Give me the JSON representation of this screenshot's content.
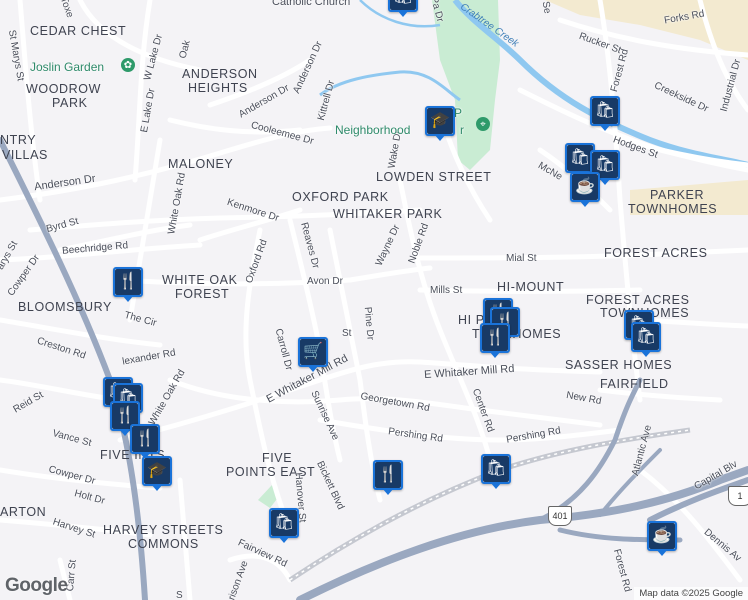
{
  "map": {
    "neighborhoods": [
      {
        "id": "cedar-chest",
        "text": "CEDAR CHEST"
      },
      {
        "id": "anderson-heights-1",
        "text": "ANDERSON"
      },
      {
        "id": "anderson-heights-2",
        "text": "HEIGHTS"
      },
      {
        "id": "woodrow-park-1",
        "text": "WOODROW"
      },
      {
        "id": "woodrow-park-2",
        "text": "PARK"
      },
      {
        "id": "country-villas-1",
        "text": "NTRY"
      },
      {
        "id": "country-villas-2",
        "text": "VILLAS"
      },
      {
        "id": "maloney",
        "text": "MALONEY"
      },
      {
        "id": "lowden-street",
        "text": "LOWDEN STREET"
      },
      {
        "id": "oxford-park",
        "text": "OXFORD PARK"
      },
      {
        "id": "whitaker-park",
        "text": "WHITAKER PARK"
      },
      {
        "id": "parker-townhomes-1",
        "text": "PARKER"
      },
      {
        "id": "parker-townhomes-2",
        "text": "TOWNHOMES"
      },
      {
        "id": "forest-acres",
        "text": "FOREST ACRES"
      },
      {
        "id": "white-oak-forest-1",
        "text": "WHITE OAK"
      },
      {
        "id": "white-oak-forest-2",
        "text": "FOREST"
      },
      {
        "id": "hi-mount",
        "text": "HI-MOUNT"
      },
      {
        "id": "bloomsbury",
        "text": "BLOOMSBURY"
      },
      {
        "id": "forest-acres-townhomes-1",
        "text": "FOREST ACRES"
      },
      {
        "id": "forest-acres-townhomes-2",
        "text": "TOWNHOMES"
      },
      {
        "id": "hi-park-townhomes-1",
        "text": "HI  PARK"
      },
      {
        "id": "hi-park-townhomes-2",
        "text": "TOWNHOMES"
      },
      {
        "id": "sasser-homes",
        "text": "SASSER HOMES"
      },
      {
        "id": "fairfield",
        "text": "FAIRFIELD"
      },
      {
        "id": "five-points",
        "text": "FIVE   INTS"
      },
      {
        "id": "five-points-east-1",
        "text": "FIVE"
      },
      {
        "id": "five-points-east-2",
        "text": "POINTS EAST"
      },
      {
        "id": "harvey-streets-1",
        "text": "HARVEY STREETS"
      },
      {
        "id": "harvey-streets-2",
        "text": "COMMONS"
      },
      {
        "id": "barton",
        "text": "ARTON"
      }
    ],
    "streets": [
      {
        "id": "catholic-church",
        "text": "Catholic Church"
      },
      {
        "id": "toxey",
        "text": "Toxe"
      },
      {
        "id": "st-marys-st-top",
        "text": "St Marys St"
      },
      {
        "id": "w-lake-dr",
        "text": "W Lake Dr"
      },
      {
        "id": "e-lake-dr",
        "text": "E Lake Dr"
      },
      {
        "id": "oakwood",
        "text": "Oak"
      },
      {
        "id": "anderson-dr-top",
        "text": "Anderson Dr"
      },
      {
        "id": "anderson-dr-mid",
        "text": "Anderson Dr"
      },
      {
        "id": "anderson-dr-left",
        "text": "Anderson Dr"
      },
      {
        "id": "kittrell",
        "text": "Kittrell Dr"
      },
      {
        "id": "cooleemee",
        "text": "Cooleemee Dr"
      },
      {
        "id": "wake-dr",
        "text": "Wake Dr"
      },
      {
        "id": "kenmore",
        "text": "Kenmore Dr"
      },
      {
        "id": "byrd",
        "text": "Byrd St"
      },
      {
        "id": "beechridge",
        "text": "Beechridge Rd"
      },
      {
        "id": "white-oak-rd",
        "text": "White Oak Rd"
      },
      {
        "id": "oxford-rd",
        "text": "Oxford Rd"
      },
      {
        "id": "reaves",
        "text": "Reaves Dr"
      },
      {
        "id": "wayne",
        "text": "Wayne Dr"
      },
      {
        "id": "noble",
        "text": "Noble Rd"
      },
      {
        "id": "avon",
        "text": "Avon Dr"
      },
      {
        "id": "mial",
        "text": "Mial St"
      },
      {
        "id": "mills",
        "text": "Mills St"
      },
      {
        "id": "cowper-dr",
        "text": "Cowper Dr"
      },
      {
        "id": "the-cir",
        "text": "The Cir"
      },
      {
        "id": "pine-dr",
        "text": "Pine Dr"
      },
      {
        "id": "creston",
        "text": "Creston Rd"
      },
      {
        "id": "alexander",
        "text": "lexander Rd"
      },
      {
        "id": "carroll",
        "text": "Carroll Dr"
      },
      {
        "id": "st-fragment",
        "text": "St"
      },
      {
        "id": "e-whitaker-mill-1",
        "text": "E Whitaker Mill Rd"
      },
      {
        "id": "e-whitaker-mill-2",
        "text": "E Whitaker Mill Rd"
      },
      {
        "id": "reid",
        "text": "Reid St"
      },
      {
        "id": "white-oak-rd-2",
        "text": "White Oak Rd"
      },
      {
        "id": "sunrise",
        "text": "Sunrise Ave"
      },
      {
        "id": "georgetown",
        "text": "Georgetown Rd"
      },
      {
        "id": "center",
        "text": "Center Rd"
      },
      {
        "id": "new-rd",
        "text": "New Rd"
      },
      {
        "id": "vance",
        "text": "Vance St"
      },
      {
        "id": "pershing-1",
        "text": "Pershing Rd"
      },
      {
        "id": "pershing-2",
        "text": "Pershing Rd"
      },
      {
        "id": "cowper-dr-2",
        "text": "Cowper Dr"
      },
      {
        "id": "holt",
        "text": "Holt Dr"
      },
      {
        "id": "bickett",
        "text": "Bickett Blvd"
      },
      {
        "id": "hanover",
        "text": "Hanover St"
      },
      {
        "id": "harvey",
        "text": "Harvey St"
      },
      {
        "id": "fairview",
        "text": "Fairview Rd"
      },
      {
        "id": "harrison",
        "text": "rison Ave"
      },
      {
        "id": "carr",
        "text": "Carr St"
      },
      {
        "id": "atlantic",
        "text": "Atlantic Ave"
      },
      {
        "id": "capital-blvd",
        "text": "Capital Blv"
      },
      {
        "id": "dennis",
        "text": "Dennis Av"
      },
      {
        "id": "forest-rd-bottom",
        "text": "Forest Rd"
      },
      {
        "id": "forest-rd-top",
        "text": "Forest Rd"
      },
      {
        "id": "rucker",
        "text": "Rucker St"
      },
      {
        "id": "parks-rd",
        "text": "Forks Rd"
      },
      {
        "id": "creekside",
        "text": "Creekside Dr"
      },
      {
        "id": "industrial",
        "text": "Industrial Dr"
      },
      {
        "id": "hodges",
        "text": "Hodges St"
      },
      {
        "id": "mcneill",
        "text": "McNe"
      },
      {
        "id": "crabtree",
        "text": "Crabtree Creek"
      },
      {
        "id": "pk-dr",
        "text": "Pa  Dr"
      },
      {
        "id": "se-top",
        "text": "Se"
      },
      {
        "id": "ntry-sts",
        "text": "arys St"
      },
      {
        "id": "s-st",
        "text": "S"
      }
    ],
    "pois": [
      {
        "id": "joslin-garden",
        "text": "Joslin Garden"
      },
      {
        "id": "neighborhood",
        "text": "Neighborhood"
      },
      {
        "id": "neighborhood-tail",
        "text": "r"
      },
      {
        "id": "p-fragment",
        "text": "P"
      }
    ],
    "shields": [
      {
        "id": "i-401",
        "text": "401"
      },
      {
        "id": "us-1",
        "text": "1"
      }
    ],
    "colors": {
      "background": "#f4f3f6",
      "road": "#ffffff",
      "highway": "#9aa8c0",
      "park": "#c9ecd3",
      "water": "#8fc8f0",
      "industrial": "#f3ead0",
      "pin_border": "#1a73d9",
      "pin_fill": "#183a66"
    },
    "attribution": "Map data ©2025 Google",
    "logo": "Google"
  }
}
